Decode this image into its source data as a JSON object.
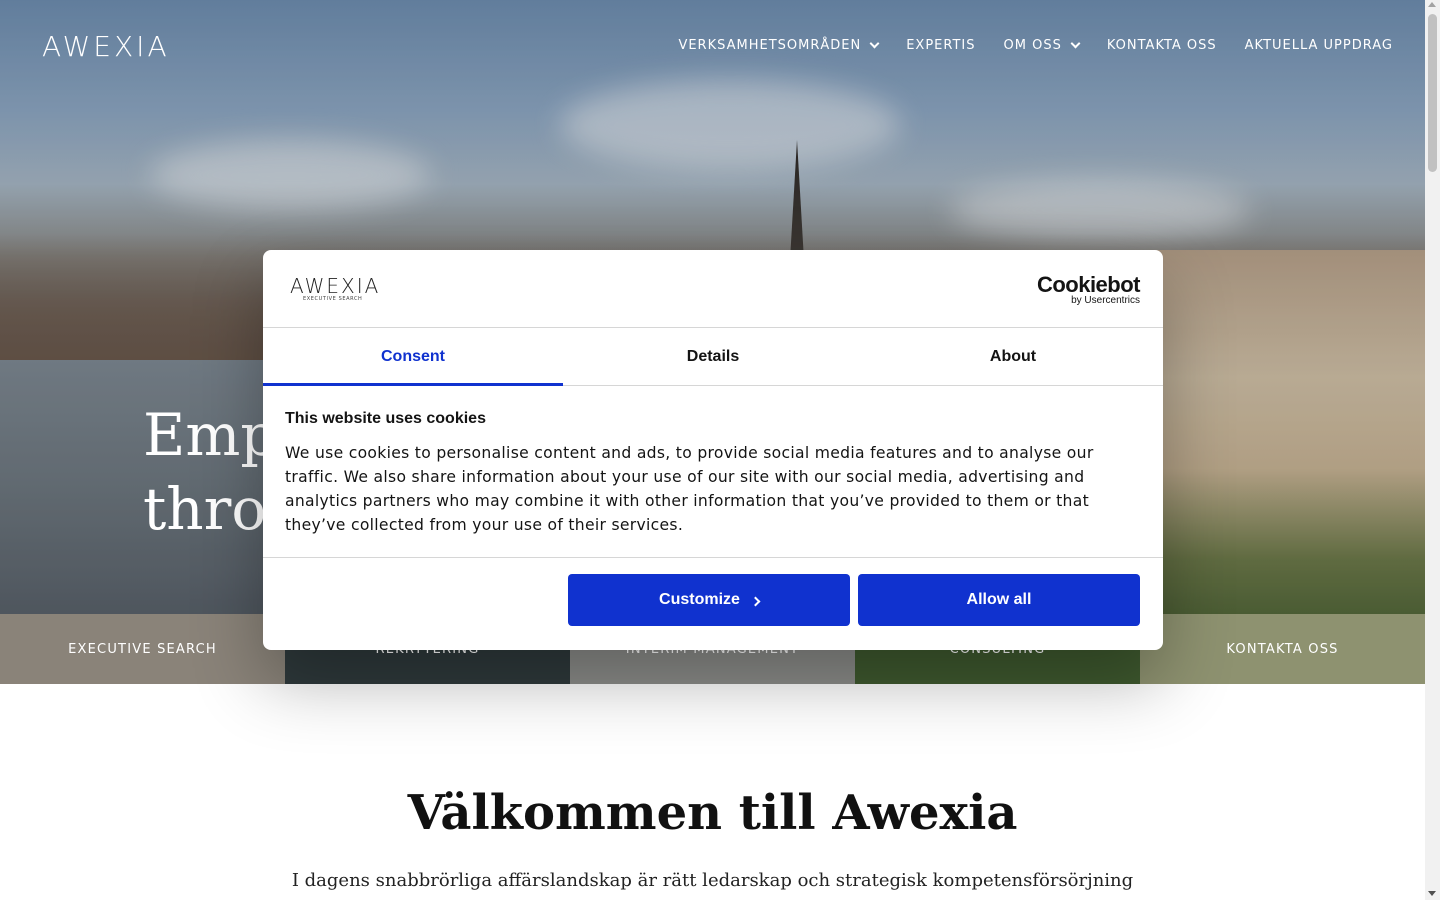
{
  "site": {
    "logo": "AWEXIA",
    "nav": [
      {
        "label": "VERKSAMHETSOMRÅDEN",
        "has_dropdown": true
      },
      {
        "label": "EXPERTIS",
        "has_dropdown": false
      },
      {
        "label": "OM OSS",
        "has_dropdown": true
      },
      {
        "label": "KONTAKTA OSS",
        "has_dropdown": false
      },
      {
        "label": "AKTUELLA UPPDRAG",
        "has_dropdown": false
      }
    ],
    "hero_line1": "Emp",
    "hero_line2": "throu",
    "strip": [
      {
        "label": "EXECUTIVE SEARCH",
        "bg": "#8a8379"
      },
      {
        "label": "REKRYTERING",
        "bg": "#2f3a3c"
      },
      {
        "label": "INTERIM MANAGEMENT",
        "bg": "#8c8d8a"
      },
      {
        "label": "CONSULTING",
        "bg": "#3f5a2f"
      },
      {
        "label": "KONTAKTA OSS",
        "bg": "#8e9270"
      }
    ],
    "welcome_title": "Välkommen till Awexia",
    "intro_text": "I dagens snabbrörliga affärslandskap är rätt ledarskap och strategisk kompetensförsörjning avgörande för att nå"
  },
  "dialog": {
    "logo": "AWEXIA",
    "logo_sub": "EXECUTIVE SEARCH",
    "cookiebot_main": "Cookiebot",
    "cookiebot_sub": "by Usercentrics",
    "tabs": [
      {
        "label": "Consent",
        "active": true
      },
      {
        "label": "Details",
        "active": false
      },
      {
        "label": "About",
        "active": false
      }
    ],
    "title": "This website uses cookies",
    "body": "We use cookies to personalise content and ads, to provide social media features and to analyse our traffic. We also share information about your use of our site with our social media, advertising and analytics partners who may combine it with other information that you’ve provided to them or that they’ve collected from your use of their services.",
    "customize_label": "Customize",
    "allow_all_label": "Allow all",
    "accent": "#1032cf"
  }
}
